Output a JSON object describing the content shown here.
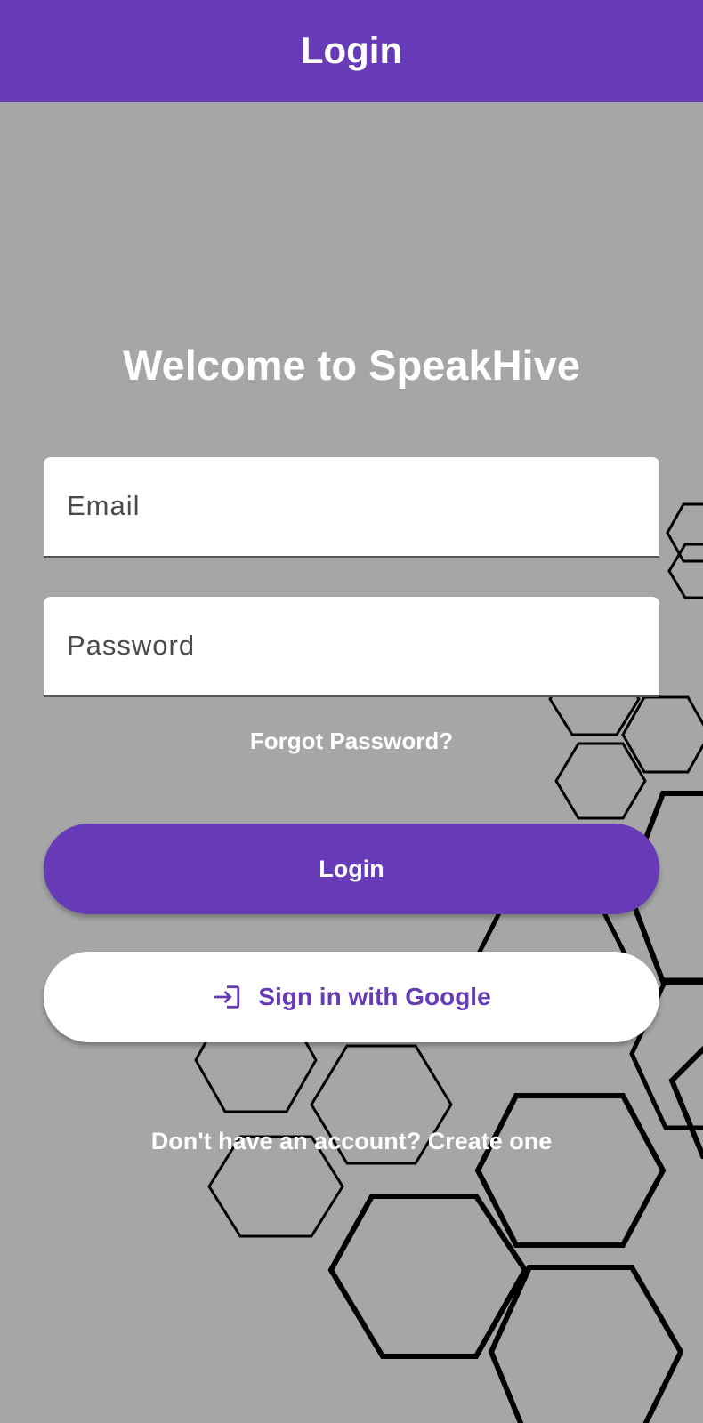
{
  "app_bar": {
    "title": "Login",
    "color": "#673ab7"
  },
  "welcome": {
    "text": "Welcome to SpeakHive"
  },
  "email_field": {
    "placeholder": "Email",
    "value": ""
  },
  "password_field": {
    "placeholder": "Password",
    "value": ""
  },
  "forgot_password": {
    "label": "Forgot Password?"
  },
  "login_button": {
    "label": "Login"
  },
  "google_button": {
    "label": "Sign in with Google",
    "icon": "login-arrow-icon"
  },
  "create_account": {
    "label": "Don't have an account? Create one"
  },
  "colors": {
    "accent": "#673ab7",
    "background": "#a6a6a6"
  }
}
